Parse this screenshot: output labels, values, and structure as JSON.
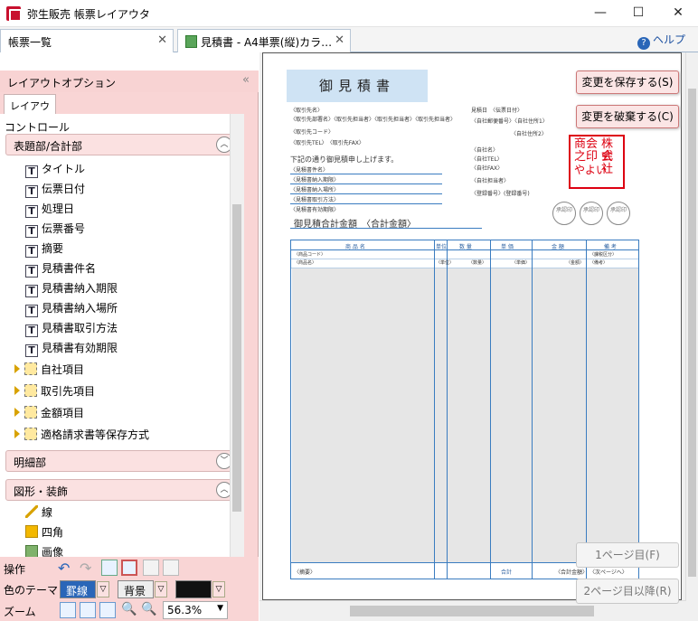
{
  "window": {
    "title": "弥生販売 帳票レイアウタ",
    "minimize": "—",
    "maximize": "☐",
    "close": "✕"
  },
  "tabs": [
    {
      "label": "帳票一覧"
    },
    {
      "label": "見積書 - A4単票(縦)カラ…"
    }
  ],
  "help_label": "ヘルプ",
  "left_panel": {
    "header": "レイアウトオプション",
    "collapse": "«",
    "subtab": "レイアウト",
    "tree_title": "コントロール",
    "groups": {
      "header_group": "表題部/合計部",
      "detail_group": "明細部",
      "shape_group": "図形・装飾"
    },
    "items": [
      "タイトル",
      "伝票日付",
      "処理日",
      "伝票番号",
      "摘要",
      "見積書件名",
      "見積書納入期限",
      "見積書納入場所",
      "見積書取引方法",
      "見積書有効期限"
    ],
    "folders": [
      "自社項目",
      "取引先項目",
      "金額項目",
      "適格請求書等保存方式"
    ],
    "shape_items": [
      "線",
      "四角",
      "画像"
    ],
    "ops_label": "操作",
    "theme_label": "色のテーマ",
    "theme_border": "罫線",
    "theme_bg": "背景",
    "zoom_label": "ズーム",
    "zoom_value": "56.3%"
  },
  "colors": {
    "accent": "#f9d5d5",
    "brand_red": "#c8102e",
    "table_blue": "#3a7cc0"
  },
  "document": {
    "title": "御見積書",
    "left_small": [
      "〈取引先名〉",
      "〈取引先部署名〉〈取引先担当者〉〈取引先担当者〉〈取引先担当者〉",
      "〈取引先コード〉",
      "〈取引先TEL〉　〈取引先FAX〉"
    ],
    "greeting": "下記の通り御見積申し上げます。",
    "fields": [
      "〈見積書件名〉",
      "〈見積書納入期限〉",
      "〈見積書納入場所〉",
      "〈見積書取引方法〉",
      "〈見積書有効期限〉"
    ],
    "total_label": "御見積合計金額　〈合計金額〉",
    "right_small": [
      "見積日　〈伝票日付〉",
      "〈自社郵便番号〉〈自社住所1〉",
      "〈自社住所2〉",
      "〈自社名〉",
      "〈自社TEL〉",
      "〈自社FAX〉",
      "〈自社担当者〉",
      "〈登録番号〉(登録番号)"
    ],
    "seal_text": [
      "株式",
      "会社",
      "やよい",
      "商会",
      "之印"
    ],
    "stamps": [
      "承認印",
      "承認印",
      "承認印"
    ],
    "table_headers": [
      "商 品 名",
      "単位",
      "数 量",
      "単 価",
      "金 額",
      "備 考"
    ],
    "row1": [
      "〈商品コード〉",
      "〈課税区分〉"
    ],
    "row2": [
      "〈商品名〉",
      "〈単位〉",
      "〈数量〉",
      "〈単価〉",
      "〈金額〉",
      "〈備考〉"
    ],
    "footer": [
      "〈摘要〉",
      "合計",
      "〈合計金額〉",
      "〈次ページへ〉"
    ]
  },
  "buttons": {
    "save": "変更を保存する(S)",
    "discard": "変更を破棄する(C)",
    "page1": "1ページ目(F)",
    "page2": "2ページ目以降(R)"
  }
}
